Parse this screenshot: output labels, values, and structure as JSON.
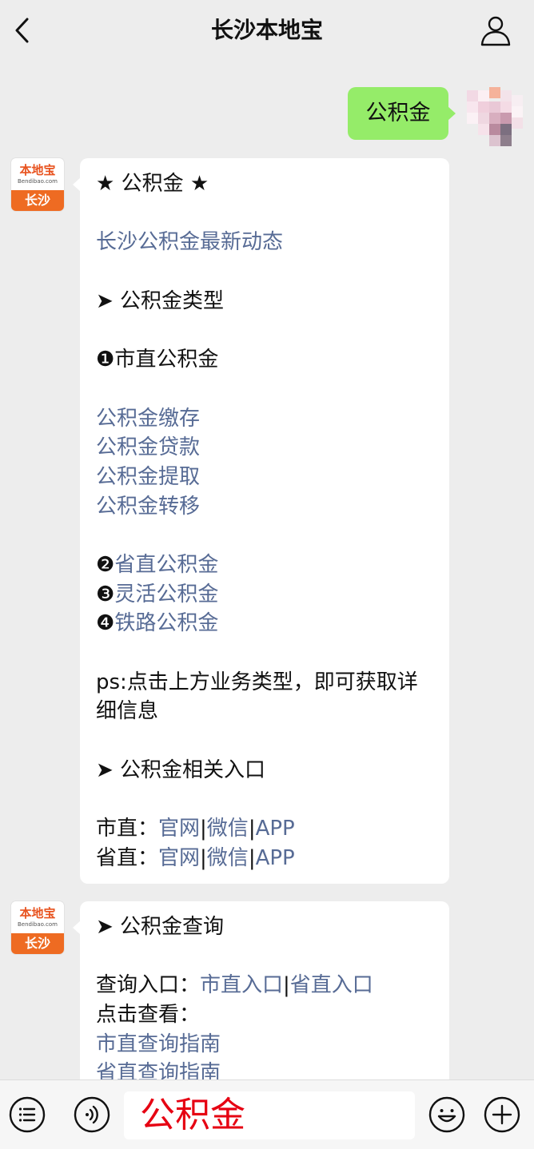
{
  "header": {
    "title": "长沙本地宝"
  },
  "outgoing": {
    "text": "公积金"
  },
  "bot": {
    "avatar_brand": "本地宝",
    "avatar_domain": "Bendibao.com",
    "avatar_city": "长沙"
  },
  "message1": {
    "heading": "★ 公积金 ★",
    "latest_link": "长沙公积金最新动态",
    "types_heading": "➤ 公积金类型",
    "city_num": "❶",
    "city_label": "市直公积金",
    "city_links": [
      "公积金缴存",
      "公积金贷款",
      "公积金提取",
      "公积金转移"
    ],
    "other_types": [
      {
        "num": "❷",
        "label": "省直公积金"
      },
      {
        "num": "❸",
        "label": "灵活公积金"
      },
      {
        "num": "❹",
        "label": "铁路公积金"
      }
    ],
    "ps_text": "ps:点击上方业务类型，即可获取详细信息",
    "entry_heading": "➤ 公积金相关入口",
    "entries": [
      {
        "label": "市直：",
        "site": "官网",
        "sep1": "|",
        "wechat": "微信",
        "sep2": "|",
        "app": "APP"
      },
      {
        "label": "省直：",
        "site": "官网",
        "sep1": "|",
        "wechat": "微信",
        "sep2": "|",
        "app": "APP"
      }
    ]
  },
  "message2": {
    "heading": "➤ 公积金查询",
    "query_label": "查询入口：",
    "query_city": "市直入口",
    "query_sep": "|",
    "query_province": "省直入口",
    "view_label": "点击查看：",
    "guides": [
      "市直查询指南",
      "省直查询指南"
    ]
  },
  "input": {
    "value": "公积金"
  },
  "colors": {
    "background": "#ededed",
    "outgoing_bubble": "#95ec69",
    "link": "#576b95",
    "input_text": "#e60012",
    "brand_orange": "#ee6b22"
  }
}
